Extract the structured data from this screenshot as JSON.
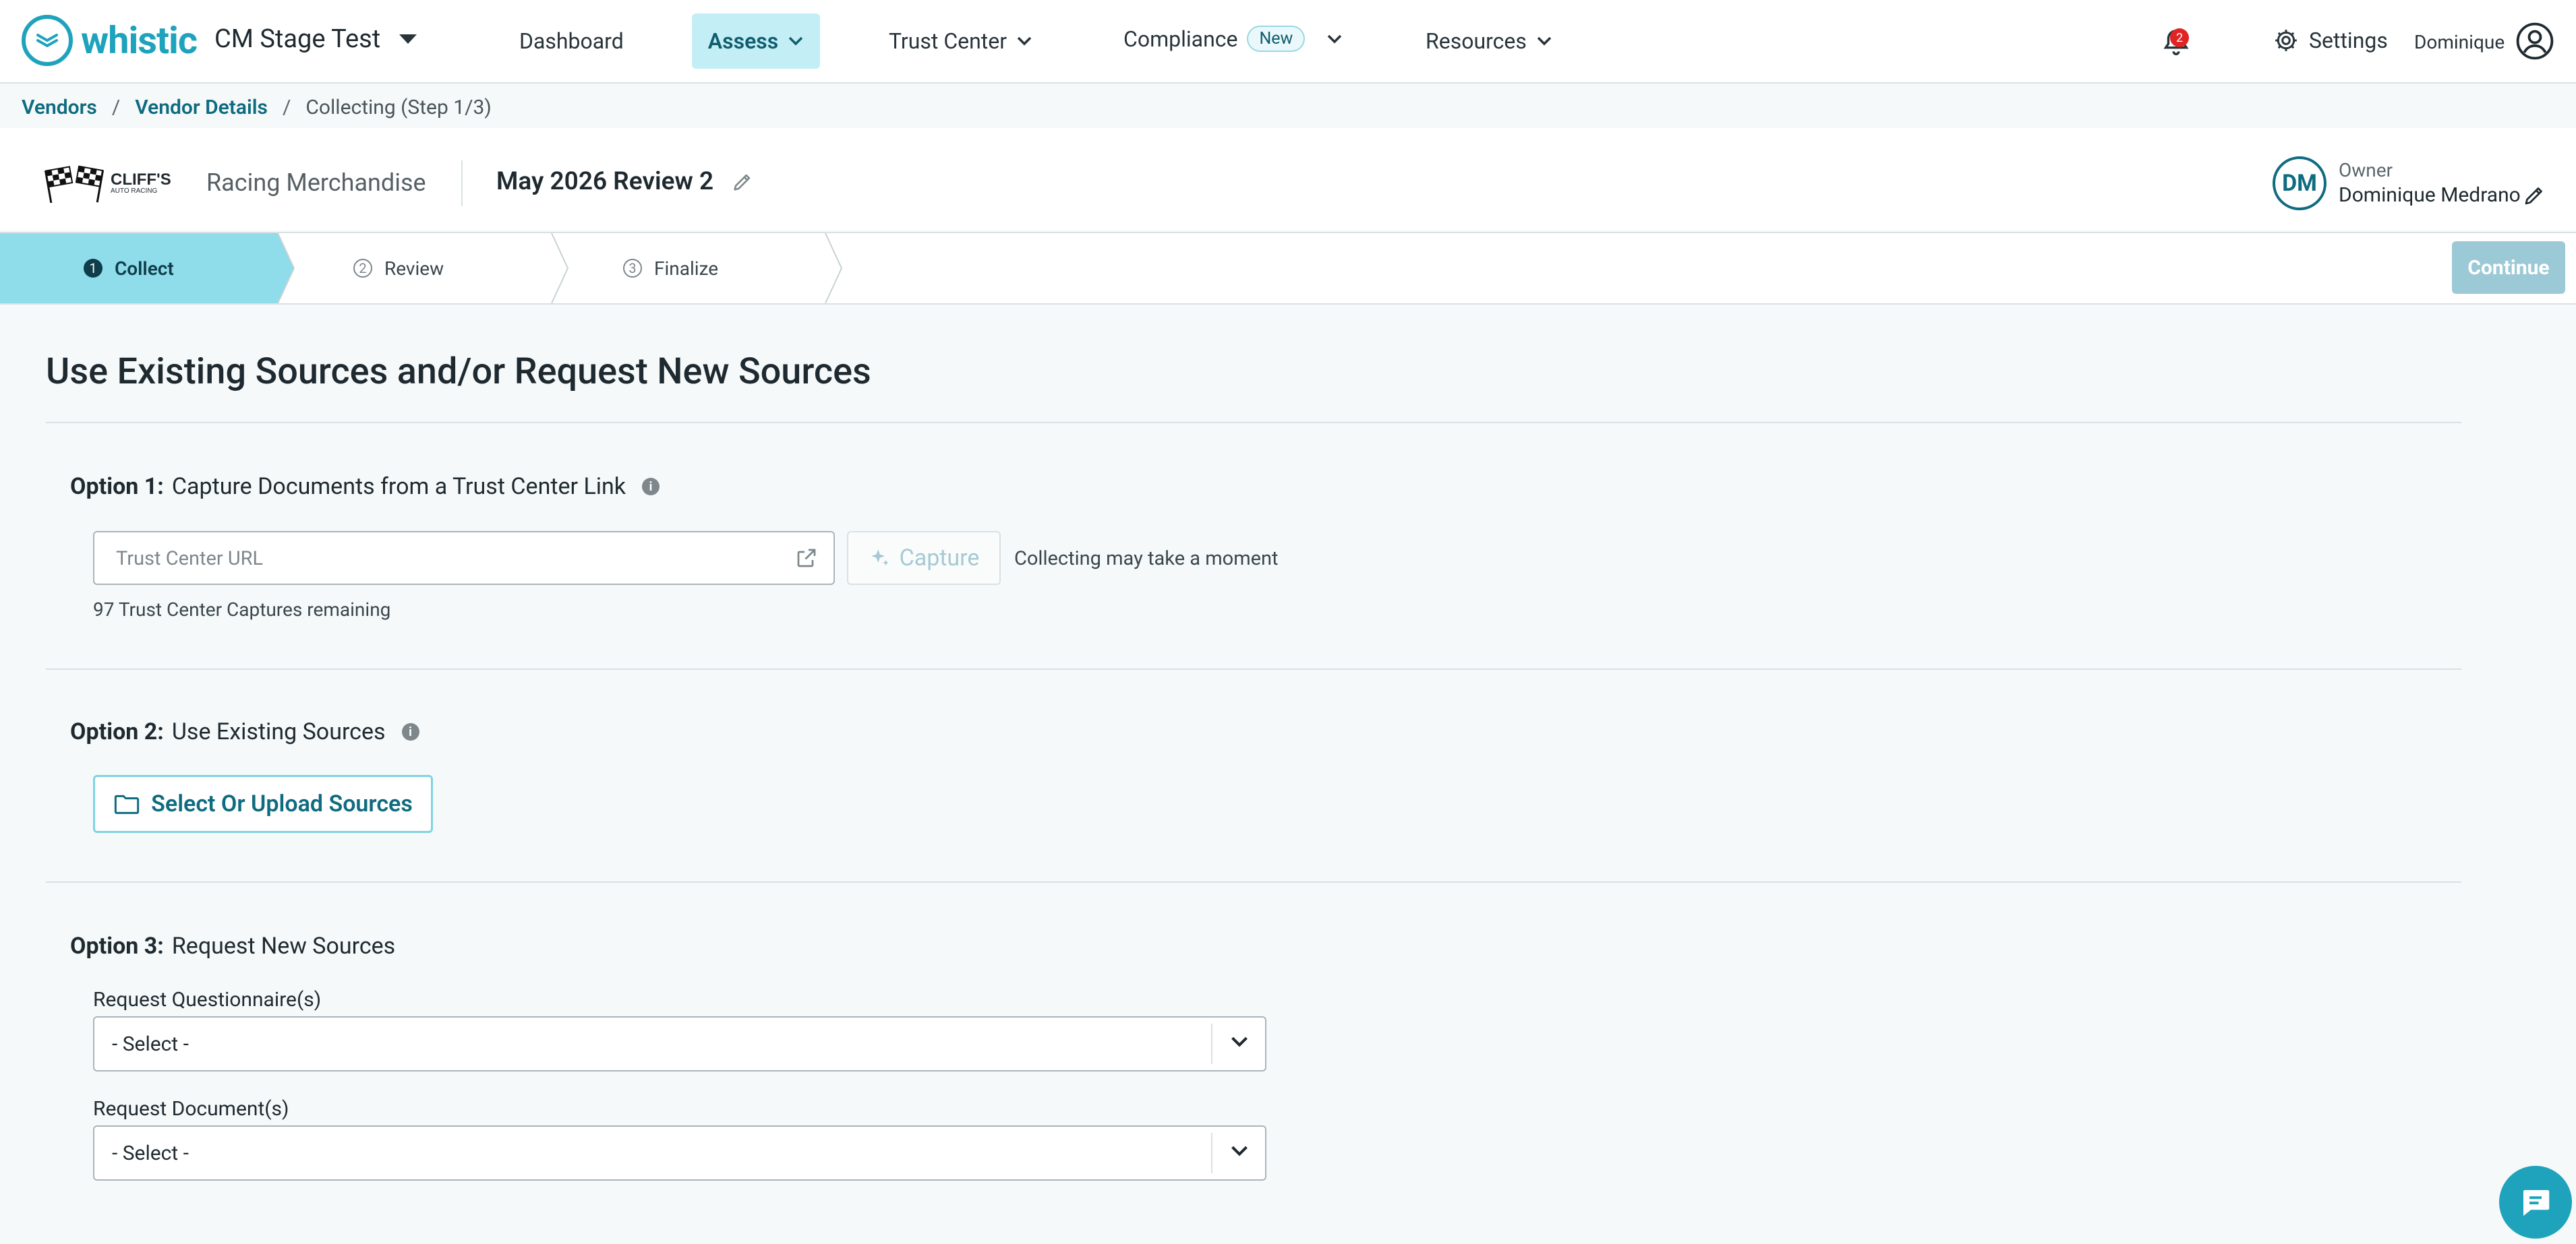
{
  "brand": {
    "name": "whistic",
    "org": "CM Stage Test"
  },
  "nav": {
    "dashboard": "Dashboard",
    "assess": "Assess",
    "trust_center": "Trust Center",
    "compliance": "Compliance",
    "new_badge": "New",
    "resources": "Resources",
    "notification_count": "2",
    "settings": "Settings",
    "user": "Dominique"
  },
  "breadcrumbs": {
    "vendors": "Vendors",
    "vendor_details": "Vendor Details",
    "current": "Collecting (Step 1/3)"
  },
  "header": {
    "vendor_logo_text": "CLIFF'S",
    "vendor_logo_sub": "AUTO RACING",
    "vendor_name": "Racing Merchandise",
    "review_title": "May 2026 Review 2",
    "owner_initials": "DM",
    "owner_label": "Owner",
    "owner_name": "Dominique Medrano"
  },
  "stepper": {
    "steps": [
      {
        "num": "1",
        "label": "Collect"
      },
      {
        "num": "2",
        "label": "Review"
      },
      {
        "num": "3",
        "label": "Finalize"
      }
    ],
    "continue": "Continue"
  },
  "main": {
    "title": "Use Existing Sources and/or Request New Sources",
    "option1": {
      "prefix": "Option 1:",
      "label": "Capture Documents from a Trust Center Link",
      "info": "i",
      "url_placeholder": "Trust Center URL",
      "capture": "Capture",
      "note": "Collecting may take a moment",
      "remaining": "97 Trust Center Captures remaining"
    },
    "option2": {
      "prefix": "Option 2:",
      "label": "Use Existing Sources",
      "info": "i",
      "button": "Select Or Upload Sources"
    },
    "option3": {
      "prefix": "Option 3:",
      "label": "Request New Sources",
      "questionnaire_label": "Request Questionnaire(s)",
      "questionnaire_value": "- Select -",
      "document_label": "Request Document(s)",
      "document_value": "- Select -"
    }
  },
  "colors": {
    "accent": "#1fa3bd",
    "active_step": "#8fdcea",
    "link": "#0f6b80",
    "continue_disabled": "#9cc9d6"
  },
  "icons": [
    "logo-icon",
    "chevron-down-icon",
    "bell-icon",
    "gear-icon",
    "user-circle-icon",
    "pencil-icon",
    "external-link-icon",
    "sparkle-icon",
    "folder-icon",
    "info-icon",
    "chat-icon"
  ]
}
